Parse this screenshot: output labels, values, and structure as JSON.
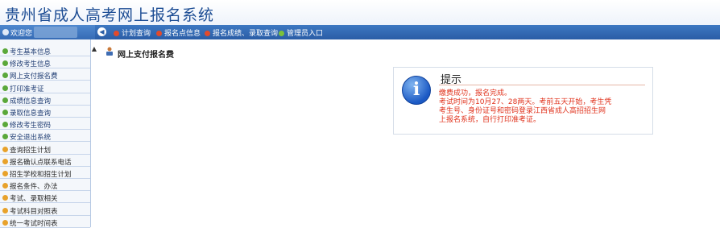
{
  "header": {
    "title": "贵州省成人高考网上报名系统"
  },
  "navbar": {
    "welcome_label": "欢迎您",
    "links": [
      {
        "label": "计划查询",
        "color": "#e24a2b"
      },
      {
        "label": "报名点信息",
        "color": "#e24a2b"
      },
      {
        "label": "报名成绩、录取查询",
        "color": "#e24a2b"
      },
      {
        "label": "管理员入口",
        "color": "#7cc13a"
      }
    ]
  },
  "sidebar": {
    "items": [
      {
        "label": "考生基本信息",
        "bullet_color": "#5aa83a"
      },
      {
        "label": "修改考生信息",
        "bullet_color": "#5aa83a"
      },
      {
        "label": "网上支付报名费",
        "bullet_color": "#5aa83a"
      },
      {
        "label": "打印准考证",
        "bullet_color": "#5aa83a"
      },
      {
        "label": "成绩信息查询",
        "bullet_color": "#5aa83a"
      },
      {
        "label": "录取信息查询",
        "bullet_color": "#5aa83a"
      },
      {
        "label": "修改考生密码",
        "bullet_color": "#5aa83a"
      },
      {
        "label": "安全退出系统",
        "bullet_color": "#5aa83a"
      },
      {
        "label": "查询招生计划",
        "bullet_color": "#e8a22b"
      },
      {
        "label": "报名确认点联系电话",
        "bullet_color": "#e8a22b"
      },
      {
        "label": "招生学校和招生计划",
        "bullet_color": "#e8a22b"
      },
      {
        "label": "报名条件、办法",
        "bullet_color": "#e8a22b"
      },
      {
        "label": "考试、录取相关",
        "bullet_color": "#e8a22b"
      },
      {
        "label": "考试科目对照表",
        "bullet_color": "#e8a22b"
      },
      {
        "label": "统一考试时间表",
        "bullet_color": "#e8a22b"
      }
    ]
  },
  "main": {
    "panel_title": "网上支付报名费",
    "alert": {
      "title": "提示",
      "icon_letter": "i",
      "lines": [
        "缴费成功，报名完成。",
        "考试时间为10月27、28两天。考前五天开始，考生凭",
        "考生号、身份证号和密码登录江西省成人高招招生网",
        "上报名系统，自行打印准考证。"
      ],
      "message_color": "#e0311b"
    }
  }
}
